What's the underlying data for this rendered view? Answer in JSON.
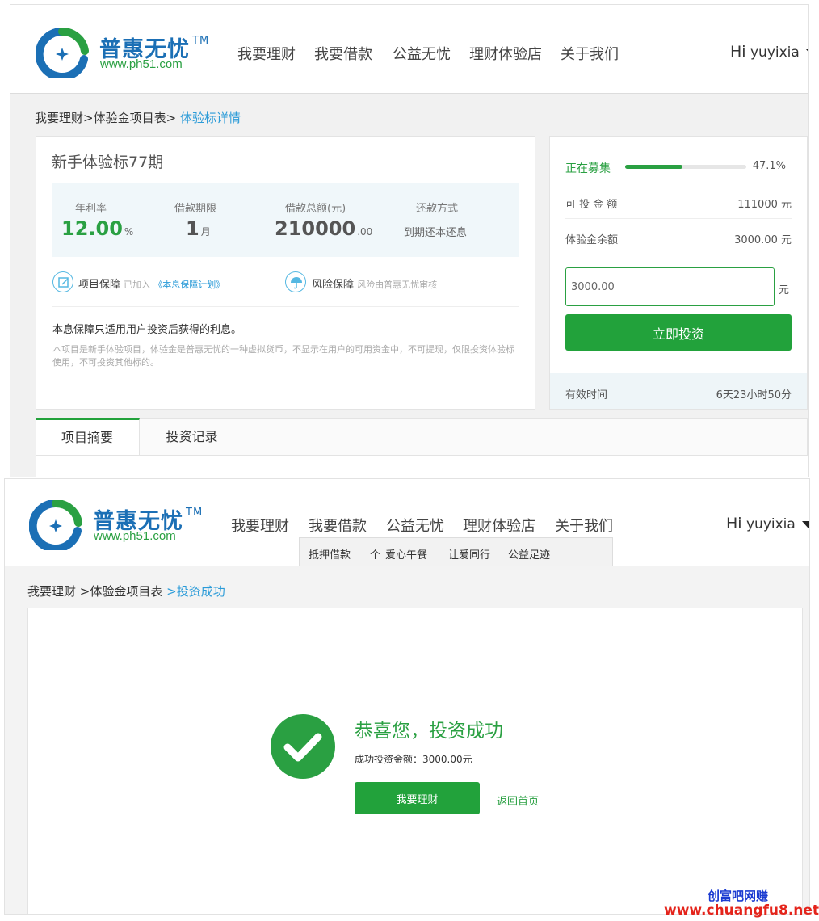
{
  "brand": {
    "name": "普惠无忧",
    "tm": "TM",
    "domain": "www.ph51.com"
  },
  "nav": {
    "items": [
      "我要理财",
      "我要借款",
      "公益无忧",
      "理财体验店",
      "关于我们"
    ]
  },
  "user": {
    "greeting": "Hi",
    "name": "yuyixia"
  },
  "detail_page": {
    "breadcrumb": {
      "item1": "我要理财",
      "sep1": ">",
      "item2": "体验金项目表",
      "sep2": ">",
      "current": "体验标详情"
    },
    "project": {
      "title": "新手体验标77期",
      "rate_label": "年利率",
      "rate_value": "12.00",
      "rate_unit": "%",
      "term_label": "借款期限",
      "term_value": "1",
      "term_unit": "月",
      "total_label": "借款总额(元)",
      "total_value": "210000",
      "total_decimals": ".00",
      "repay_label": "还款方式",
      "repay_value": "到期还本还息"
    },
    "guarantee": {
      "project_title": "项目保障",
      "project_joined": "已加入",
      "project_plan": "《本息保障计划》",
      "risk_title": "风险保障",
      "risk_desc": "风险由普惠无忧审核"
    },
    "notes": {
      "line1": "本息保障只适用用户投资后获得的利息。",
      "line2": "本项目是新手体验项目，体验金是普惠无忧的一种虚拟货币，不显示在用户的可用资金中，不可提现，仅限投资体验标使用，不可投资其他标的。"
    },
    "sidebar": {
      "status_label": "正在募集",
      "progress_percent": 47.1,
      "progress_text": "47.1%",
      "available_label": "可 投 金 额",
      "available_value": "111000 元",
      "balance_label": "体验金余额",
      "balance_value": "3000.00 元",
      "amount_input": "3000.00",
      "amount_unit": "元",
      "invest_button": "立即投资",
      "valid_label": "有效时间",
      "valid_value": "6天23小时50分"
    },
    "tabs": [
      "项目摘要",
      "投资记录"
    ]
  },
  "success_page": {
    "submenu": [
      "抵押借款",
      "个",
      "爱心午餐",
      "让爱同行",
      "公益足迹"
    ],
    "breadcrumb": {
      "item1": "我要理财",
      "item2": ">体验金项目表",
      "current": ">投资成功"
    },
    "title": "恭喜您，投资成功",
    "amount_text": "成功投资金额：3000.00元",
    "primary_button": "我要理财",
    "home_link": "返回首页"
  },
  "watermark": {
    "line1": "创富吧网赚",
    "line2": "www.chuangfu8.net"
  },
  "colors": {
    "brand_blue": "#1b6fb5",
    "accent_green": "#2aa042",
    "button_green": "#22a23b",
    "link_blue": "#2b9bd8",
    "watermark_red": "#e4241b"
  }
}
